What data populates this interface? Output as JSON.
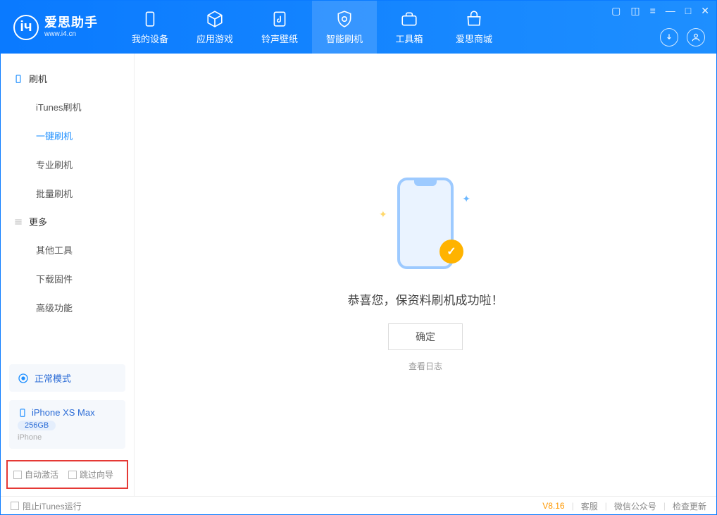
{
  "app": {
    "title": "爱思助手",
    "subtitle": "www.i4.cn"
  },
  "nav": {
    "items": [
      {
        "label": "我的设备"
      },
      {
        "label": "应用游戏"
      },
      {
        "label": "铃声壁纸"
      },
      {
        "label": "智能刷机"
      },
      {
        "label": "工具箱"
      },
      {
        "label": "爱思商城"
      }
    ]
  },
  "sidebar": {
    "group1": {
      "title": "刷机",
      "items": [
        "iTunes刷机",
        "一键刷机",
        "专业刷机",
        "批量刷机"
      ]
    },
    "group2": {
      "title": "更多",
      "items": [
        "其他工具",
        "下载固件",
        "高级功能"
      ]
    }
  },
  "mode": {
    "label": "正常模式"
  },
  "device": {
    "name": "iPhone XS Max",
    "capacity": "256GB",
    "type": "iPhone"
  },
  "options": {
    "autoActivate": "自动激活",
    "skipGuide": "跳过向导"
  },
  "main": {
    "successText": "恭喜您，保资料刷机成功啦！",
    "okButton": "确定",
    "viewLog": "查看日志"
  },
  "footer": {
    "blockItunes": "阻止iTunes运行",
    "version": "V8.16",
    "links": [
      "客服",
      "微信公众号",
      "检查更新"
    ]
  }
}
